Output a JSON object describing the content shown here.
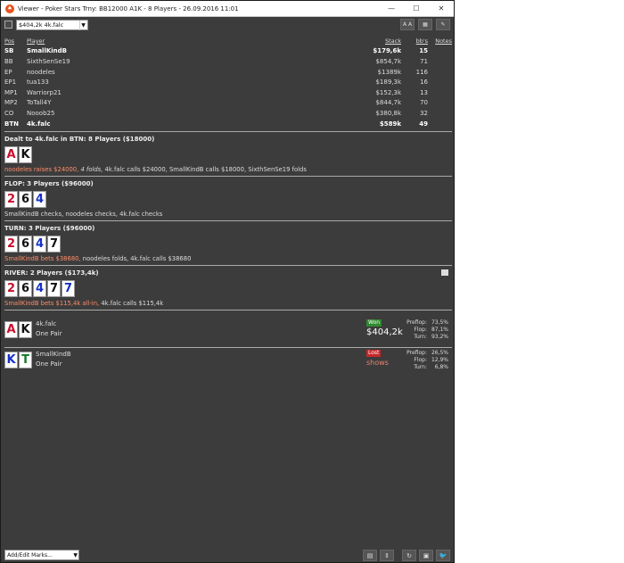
{
  "window": {
    "title": "Viewer - Poker Stars Trny: BB12000 A1K - 8 Players - 26.09.2016 11:01",
    "icon": "poker-app-icon"
  },
  "toolbar": {
    "hand_select": "$404,2k 4k.falc",
    "font_button": "A A",
    "grid_button": "grid-icon",
    "pen_button": "pen-icon"
  },
  "players": {
    "headers": {
      "pos": "Pos",
      "player": "Player",
      "stack": "Stack",
      "bbs": "bb's",
      "notes": "Notes"
    },
    "rows": [
      {
        "pos": "SB",
        "player": "SmallKindB",
        "stack": "$179,6k",
        "bbs": "15"
      },
      {
        "pos": "BB",
        "player": "SixthSenSe19",
        "stack": "$854,7k",
        "bbs": "71"
      },
      {
        "pos": "EP",
        "player": "noodeles",
        "stack": "$1389k",
        "bbs": "116"
      },
      {
        "pos": "EP1",
        "player": "tua133",
        "stack": "$189,3k",
        "bbs": "16"
      },
      {
        "pos": "MP1",
        "player": "Warriorp21",
        "stack": "$152,3k",
        "bbs": "13"
      },
      {
        "pos": "MP2",
        "player": "ToTall4Y",
        "stack": "$844,7k",
        "bbs": "70"
      },
      {
        "pos": "CO",
        "player": "Nooob25",
        "stack": "$380,8k",
        "bbs": "32"
      },
      {
        "pos": "BTN",
        "player": "4k.falc",
        "stack": "$589k",
        "bbs": "49"
      }
    ]
  },
  "preflop": {
    "title": "Dealt to 4k.falc in BTN: 8 Players ($18000)",
    "cards": [
      {
        "r": "A",
        "c": "red"
      },
      {
        "r": "K",
        "c": "blk"
      }
    ],
    "action_hl": "noodeles raises $24000,",
    "action_it": " 4 folds,",
    "action_rest": " 4k.falc calls $24000, SmallKindB calls $18000, SixthSenSe19 folds"
  },
  "flop": {
    "title": "FLOP: 3 Players ($96000)",
    "cards": [
      {
        "r": "2",
        "c": "red"
      },
      {
        "r": "6",
        "c": "blk"
      },
      {
        "r": "4",
        "c": "blu"
      }
    ],
    "action": "SmallKindB checks, noodeles checks, 4k.falc checks"
  },
  "turn": {
    "title": "TURN: 3 Players ($96000)",
    "cards": [
      {
        "r": "2",
        "c": "red"
      },
      {
        "r": "6",
        "c": "blk"
      },
      {
        "r": "4",
        "c": "blu"
      },
      {
        "r": "7",
        "c": "blk"
      }
    ],
    "action_hl": "SmallKindB bets $38680,",
    "action_rest": " noodeles folds, 4k.falc calls $38680"
  },
  "river": {
    "title": "RIVER: 2 Players ($173,4k)",
    "cards": [
      {
        "r": "2",
        "c": "red"
      },
      {
        "r": "6",
        "c": "blk"
      },
      {
        "r": "4",
        "c": "blu"
      },
      {
        "r": "7",
        "c": "blk"
      },
      {
        "r": "7",
        "c": "blu"
      }
    ],
    "action_hl": "SmallKindB bets $115,4k all-in,",
    "action_rest": " 4k.falc calls $115,4k"
  },
  "results": [
    {
      "cards": [
        {
          "r": "A",
          "c": "red"
        },
        {
          "r": "K",
          "c": "blk"
        }
      ],
      "name": "4k.falc",
      "hand": "One Pair",
      "badge": "Won",
      "amount": "$404,2k",
      "stats": [
        {
          "l": "Preflop:",
          "v": "73,5%"
        },
        {
          "l": "Flop:",
          "v": "87,1%"
        },
        {
          "l": "Turn:",
          "v": "93,2%"
        }
      ]
    },
    {
      "cards": [
        {
          "r": "K",
          "c": "blu"
        },
        {
          "r": "T",
          "c": "grn"
        }
      ],
      "name": "SmallKindB",
      "hand": "One Pair",
      "badge": "Lost",
      "shows": "shows",
      "stats": [
        {
          "l": "Preflop:",
          "v": "26,5%"
        },
        {
          "l": "Flop:",
          "v": "12,9%"
        },
        {
          "l": "Turn:",
          "v": "6,8%"
        }
      ]
    }
  ],
  "footer": {
    "marks": "Add/Edit Marks..."
  }
}
